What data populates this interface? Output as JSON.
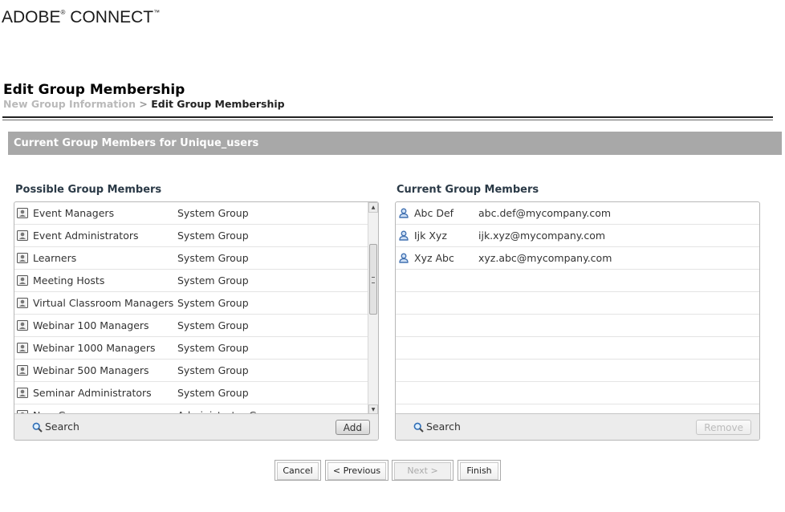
{
  "brand": {
    "name": "ADOBE",
    "reg": "®",
    "product": "CONNECT",
    "tm": "™"
  },
  "page": {
    "title": "Edit Group Membership"
  },
  "breadcrumb": {
    "previous": "New Group Information",
    "separator": ">",
    "current": "Edit Group Membership"
  },
  "section": {
    "header": "Current Group Members for Unique_users"
  },
  "possible": {
    "title": "Possible Group Members",
    "rows": [
      {
        "name": "Event Managers",
        "type": "System Group"
      },
      {
        "name": "Event Administrators",
        "type": "System Group"
      },
      {
        "name": "Learners",
        "type": "System Group"
      },
      {
        "name": "Meeting Hosts",
        "type": "System Group"
      },
      {
        "name": "Virtual Classroom Managers",
        "type": "System Group"
      },
      {
        "name": "Webinar 100 Managers",
        "type": "System Group"
      },
      {
        "name": "Webinar 1000 Managers",
        "type": "System Group"
      },
      {
        "name": "Webinar 500 Managers",
        "type": "System Group"
      },
      {
        "name": "Seminar Administrators",
        "type": "System Group"
      },
      {
        "name": "New Group",
        "type": "Administrator Group"
      }
    ],
    "search_label": "Search",
    "add_label": "Add"
  },
  "current": {
    "title": "Current Group Members",
    "rows": [
      {
        "name": "Abc Def",
        "email": "abc.def@mycompany.com"
      },
      {
        "name": "Ijk Xyz",
        "email": "ijk.xyz@mycompany.com"
      },
      {
        "name": "Xyz Abc",
        "email": "xyz.abc@mycompany.com"
      }
    ],
    "search_label": "Search",
    "remove_label": "Remove"
  },
  "nav": {
    "cancel": "Cancel",
    "previous": "< Previous",
    "next": "Next >",
    "finish": "Finish"
  },
  "colors": {
    "header_bar": "#a8a8a8",
    "panel_title": "#2b3a47",
    "user_icon": "#3f6fb0"
  }
}
